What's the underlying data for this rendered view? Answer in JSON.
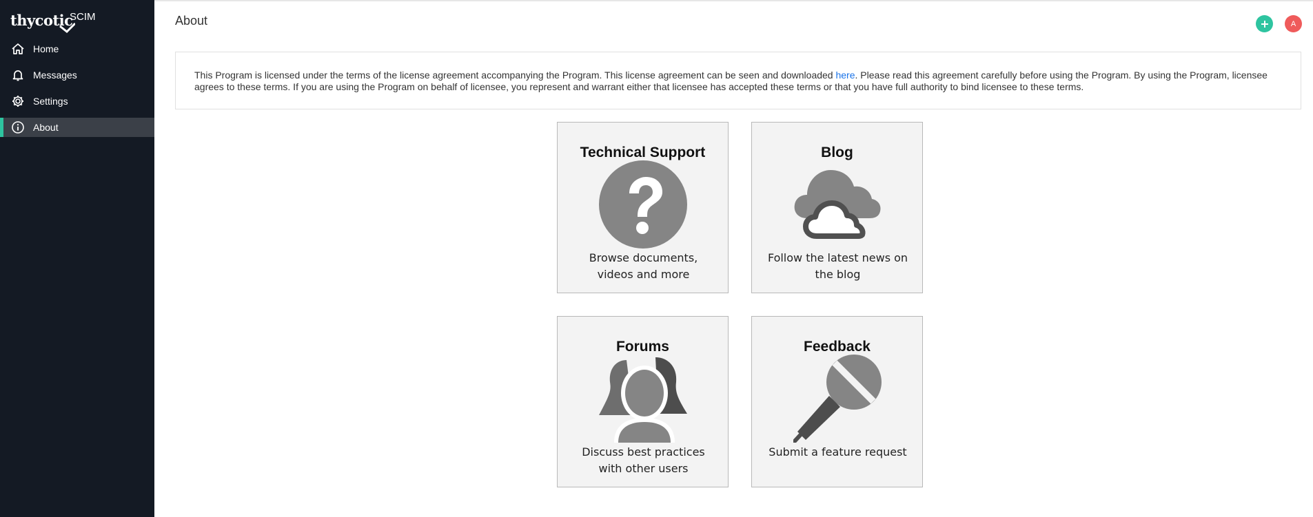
{
  "brand": {
    "logo": "thycotic",
    "product": "SCIM"
  },
  "sidebar": {
    "items": [
      {
        "label": "Home",
        "icon": "home-icon"
      },
      {
        "label": "Messages",
        "icon": "bell-icon"
      },
      {
        "label": "Settings",
        "icon": "gear-icon"
      },
      {
        "label": "About",
        "icon": "info-icon",
        "active": true
      }
    ]
  },
  "header": {
    "title": "About",
    "add_button": "+",
    "avatar": "A"
  },
  "colors": {
    "accent": "#2ec4a0",
    "avatar": "#ef5b5b",
    "sidebar_bg": "#141a24",
    "link": "#1a73e8"
  },
  "license": {
    "before_link": "This Program is licensed under the terms of the license agreement accompanying the Program. This license agreement can be seen and downloaded ",
    "link": "here",
    "after_link": ". Please read this agreement carefully before using the Program. By using the Program, licensee agrees to these terms. If you are using the Program on behalf of licensee, you represent and warrant either that licensee has accepted these terms or that you have full authority to bind licensee to these terms."
  },
  "cards": [
    {
      "title": "Technical Support",
      "description": "Browse documents, videos and more",
      "icon": "question-icon"
    },
    {
      "title": "Blog",
      "description": "Follow the latest news on the blog",
      "icon": "cloud-icon"
    },
    {
      "title": "Forums",
      "description": "Discuss best practices with other users",
      "icon": "users-icon"
    },
    {
      "title": "Feedback",
      "description": "Submit a feature request",
      "icon": "microphone-icon"
    }
  ]
}
